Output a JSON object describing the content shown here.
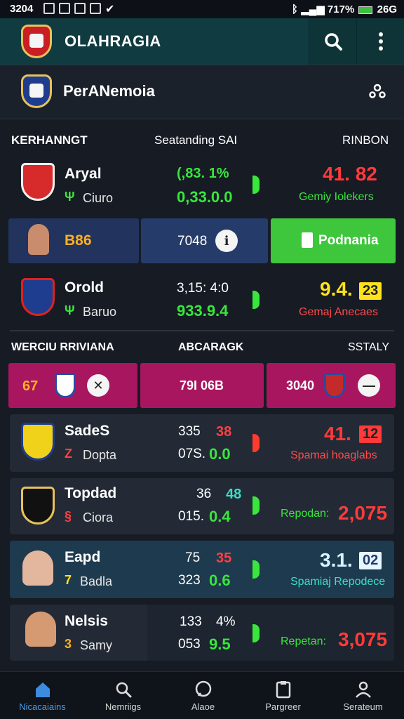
{
  "status_bar": {
    "time": "3204",
    "battery": "717%",
    "signal_text": "26G"
  },
  "app_bar": {
    "title": "OLAHRAGIA"
  },
  "league": {
    "title": "PerANemoia"
  },
  "section1": {
    "left": "KERHANNGT",
    "center": "Seatanding SAI",
    "right": "RINBON"
  },
  "section2": {
    "left": "WERCIU RRIVIANA",
    "center": "ABCARAGK",
    "right": "SSTALY"
  },
  "match1": {
    "name": "Aryal",
    "sub": "Ciuro",
    "sub_icon": "Ψ",
    "top_value": "(,83. 1%",
    "bottom_value": "0,33.0.0",
    "big_value": "41. 82",
    "label": "Gemiy Iolekers"
  },
  "bar_row1": {
    "left_text": "B86",
    "mid_text": "7048",
    "cta_label": "Podnania"
  },
  "match2": {
    "name": "Orold",
    "sub": "Baruo",
    "sub_icon": "Ψ",
    "top_value": "3,15: 4:0",
    "bottom_value": "933.9.4",
    "big_value": "9.4.",
    "box_value": "23",
    "label": "Gemaj Anecaes"
  },
  "bar_row2": {
    "left_text": "67",
    "mid_text": "79I 06B",
    "right_text": "3040"
  },
  "rows": [
    {
      "name": "SadeS",
      "sub": "Dopta",
      "sub_icon": "Z",
      "top_white": "335",
      "top_colored": "38",
      "bottom_white": "07S.",
      "bottom_green": "0.0",
      "big_value": "41.",
      "box_value": "12",
      "label": "Spamai hoaglabs",
      "flag": "red"
    },
    {
      "name": "Topdad",
      "sub": "Ciora",
      "sub_icon": "§",
      "top_white": "36",
      "top_colored": "48",
      "bottom_white": "015.",
      "bottom_green": "0.4",
      "label": "Repodan:",
      "big_value": "2,075",
      "flag": "green"
    },
    {
      "name": "Eapd",
      "sub": "Badla",
      "sub_icon": "7",
      "top_white": "75",
      "top_colored": "35",
      "bottom_white": "323",
      "bottom_green": "0.6",
      "big_value": "3.1.",
      "box_value": "02",
      "label": "Spamiaj Repodece",
      "flag": "green"
    },
    {
      "name": "Nelsis",
      "sub": "Samy",
      "sub_icon": "3",
      "top_white": "133",
      "top_colored": "4%",
      "bottom_white": "053",
      "bottom_green": "9.5",
      "label": "Repetan:",
      "big_value": "3,075",
      "flag": "green"
    }
  ],
  "bottom_nav": [
    {
      "label": "Nicacaiains",
      "icon": "home-icon"
    },
    {
      "label": "Nemriigs",
      "icon": "search-icon"
    },
    {
      "label": "Alaoe",
      "icon": "chat-icon"
    },
    {
      "label": "Pargreer",
      "icon": "clipboard-icon"
    },
    {
      "label": "Serateum",
      "icon": "person-icon"
    }
  ],
  "colors": {
    "accent_green": "#39e63c",
    "accent_red": "#ff3a3a",
    "magenta": "#a8165f",
    "navy": "#22335e",
    "teal_bar": "#103b40"
  }
}
